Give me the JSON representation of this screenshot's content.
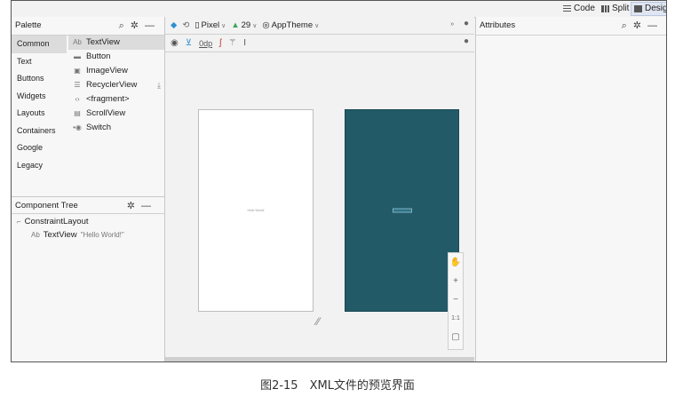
{
  "view_modes": {
    "code": "Code",
    "split": "Split",
    "design": "Design",
    "active": "Design"
  },
  "palette": {
    "title": "Palette",
    "categories": [
      "Common",
      "Text",
      "Buttons",
      "Widgets",
      "Layouts",
      "Containers",
      "Google",
      "Legacy"
    ],
    "selected_category": "Common",
    "items": [
      {
        "label": "TextView",
        "icon": "Ab"
      },
      {
        "label": "Button",
        "icon": "button-icon"
      },
      {
        "label": "ImageView",
        "icon": "image-icon"
      },
      {
        "label": "RecyclerView",
        "icon": "list-icon"
      },
      {
        "label": "<fragment>",
        "icon": "fragment-icon"
      },
      {
        "label": "ScrollView",
        "icon": "scroll-icon"
      },
      {
        "label": "Switch",
        "icon": "switch-icon"
      }
    ]
  },
  "component_tree": {
    "title": "Component Tree",
    "root": "ConstraintLayout",
    "child_icon": "Ab",
    "child": "TextView",
    "child_text": "\"Hello World!\""
  },
  "toolbar": {
    "device": "Pixel",
    "api": "29",
    "theme": "AppTheme",
    "margin": "0dp"
  },
  "preview": {
    "hello_text": "Hello World!",
    "zoom_label": "1:1"
  },
  "attributes": {
    "title": "Attributes"
  },
  "caption": "图2-15　XML文件的预览界面"
}
